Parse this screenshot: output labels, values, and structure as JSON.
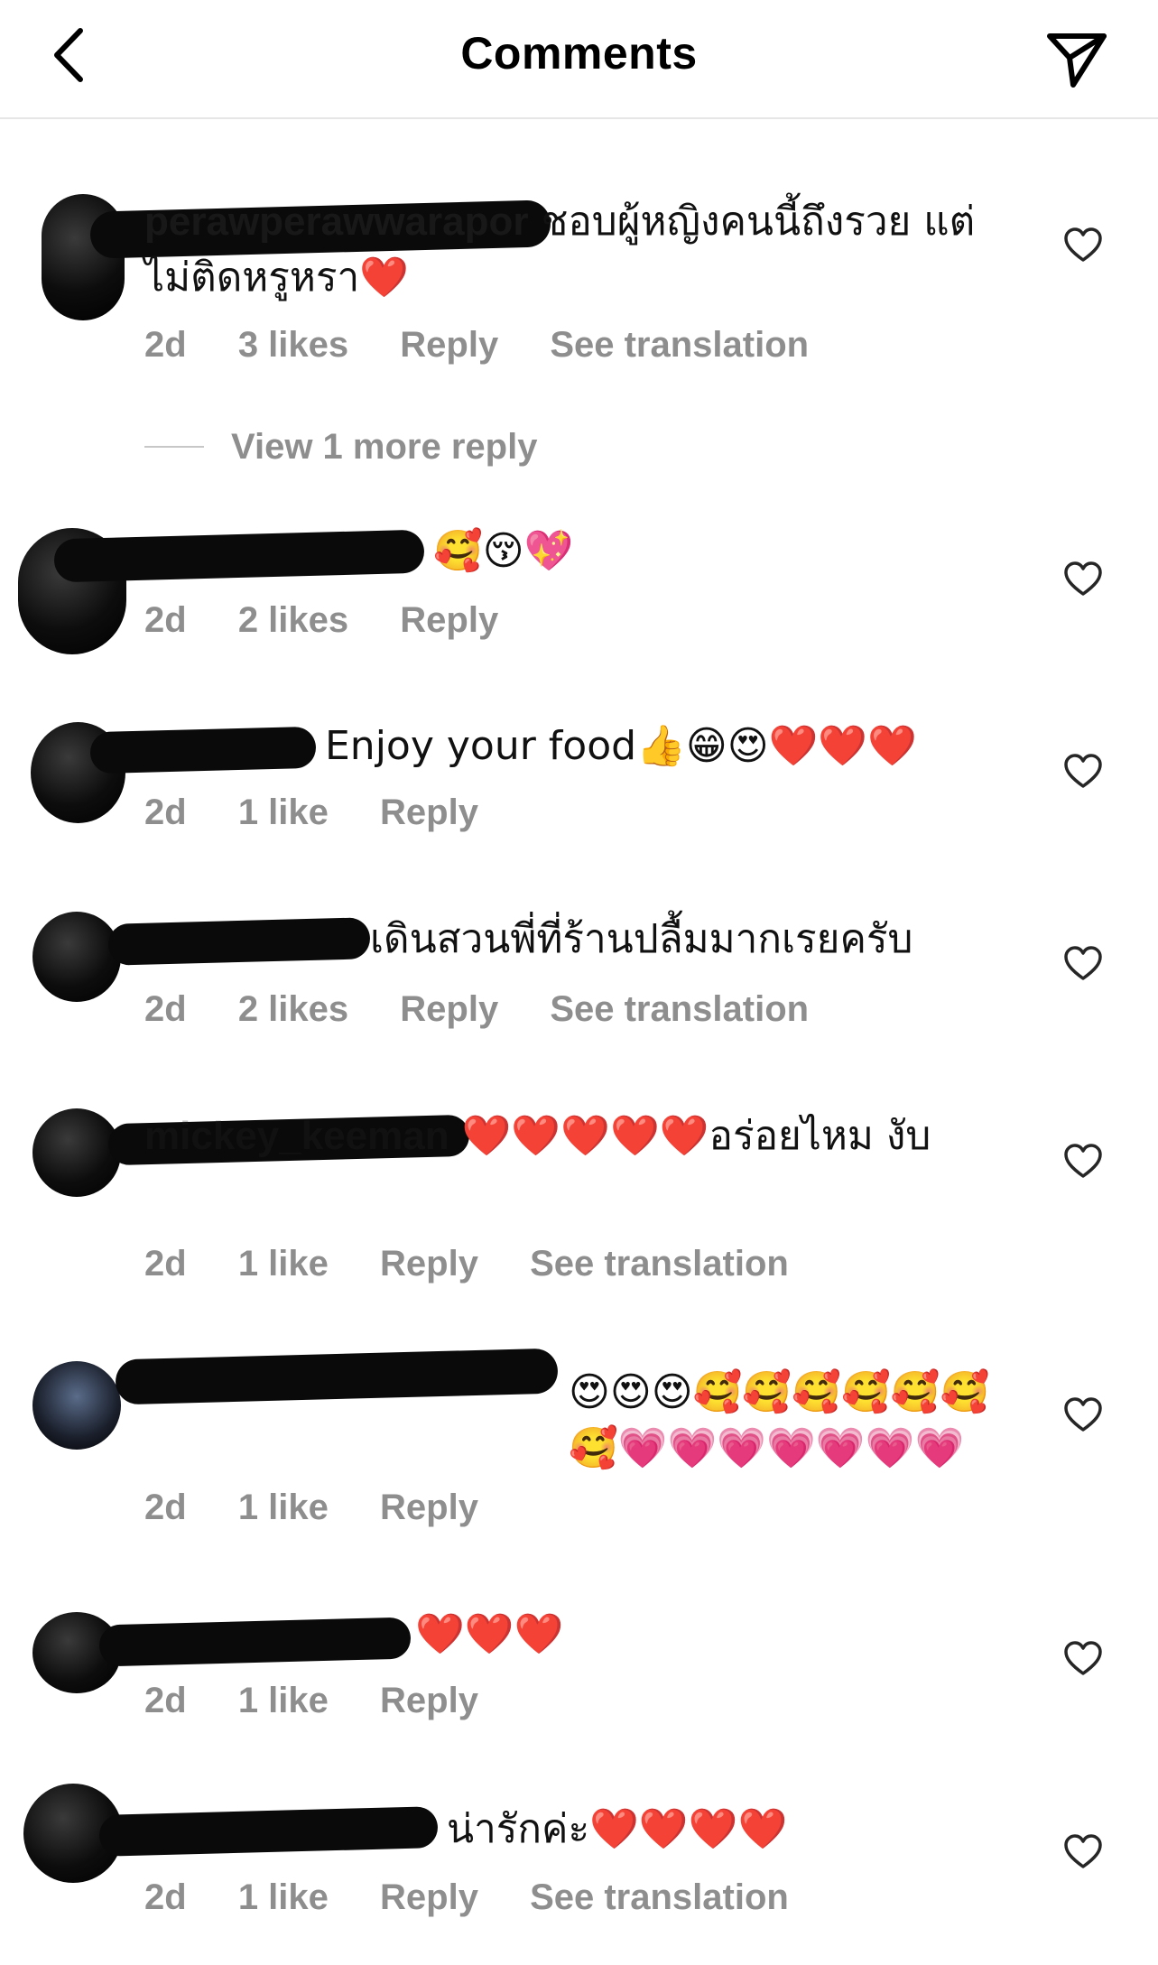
{
  "header": {
    "title": "Comments",
    "back_icon": "chevron-left-icon",
    "share_icon": "paper-plane-icon"
  },
  "comments": [
    {
      "username": "perawperawwarapor",
      "text": "ชอบผู้หญิงคนนี้ถึงรวย แต่ไม่ติดหรูหรา❤️",
      "time": "2d",
      "likes": "3 likes",
      "reply": "Reply",
      "translation": "See translation"
    },
    {
      "username": "",
      "text": "🥰😚💖",
      "time": "2d",
      "likes": "2 likes",
      "reply": "Reply"
    },
    {
      "username": "",
      "text": "Enjoy your food👍😁😍❤️❤️❤️",
      "time": "2d",
      "likes": "1 like",
      "reply": "Reply"
    },
    {
      "username": "",
      "text": "เดินสวนพี่ที่ร้านปลื้มมากเรยครับ",
      "time": "2d",
      "likes": "2 likes",
      "reply": "Reply",
      "translation": "See translation"
    },
    {
      "username": "mickey_keeman",
      "text": "❤️❤️❤️❤️❤️อร่อยไหม งับ",
      "time": "2d",
      "likes": "1 like",
      "reply": "Reply",
      "translation": "See translation"
    },
    {
      "username": "",
      "text": "😍😍😍🥰🥰🥰🥰🥰🥰🥰💗💗💗💗💗💗💗",
      "time": "2d",
      "likes": "1 like",
      "reply": "Reply"
    },
    {
      "username": "",
      "text": "❤️❤️❤️",
      "time": "2d",
      "likes": "1 like",
      "reply": "Reply"
    },
    {
      "username": "",
      "text": "น่ารักค่ะ❤️❤️❤️❤️",
      "time": "2d",
      "likes": "1 like",
      "reply": "Reply",
      "translation": "See translation"
    }
  ],
  "view_replies": "View 1 more reply",
  "colors": {
    "meta": "#8e8e8e",
    "divider": "#e6e6e6"
  }
}
